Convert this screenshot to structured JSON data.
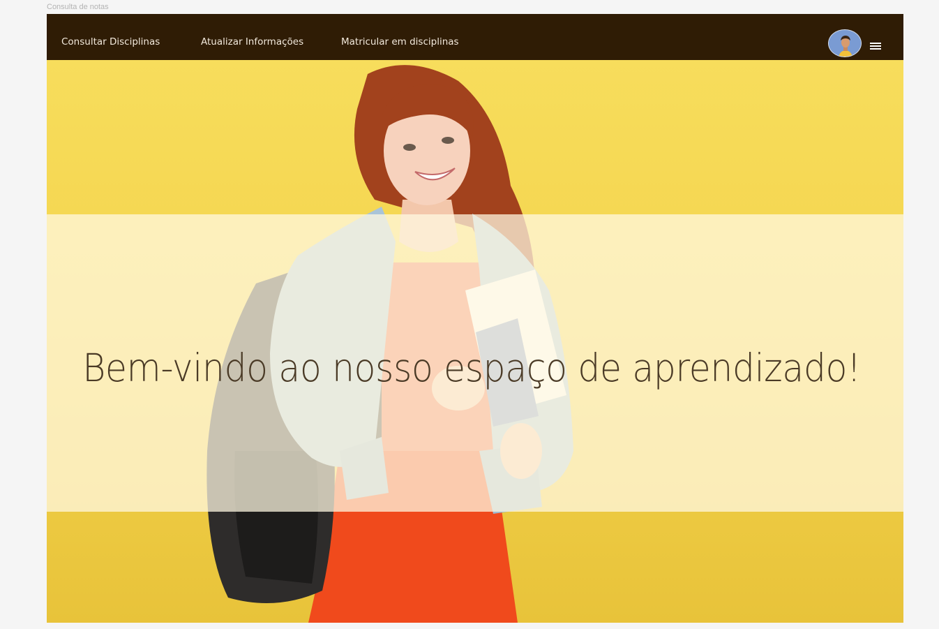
{
  "frame_label": "Consulta de notas",
  "nav": {
    "links": [
      {
        "label": "Consultar Disciplinas"
      },
      {
        "label": "Atualizar Informações"
      },
      {
        "label": "Matricular em disciplinas"
      }
    ],
    "avatar_icon": "user-avatar-icon",
    "menu_icon": "hamburger-menu-icon"
  },
  "hero": {
    "welcome_text": "Bem-vindo ao nosso espaço de aprendizado!",
    "image_description_icon": "student-photo"
  },
  "colors": {
    "navbar": "#2f1c05",
    "nav_text": "#f2e9dc",
    "hero_yellow": "#f4d44d",
    "overlay": "#fff8e1",
    "welcome_text": "#4a3a26"
  }
}
